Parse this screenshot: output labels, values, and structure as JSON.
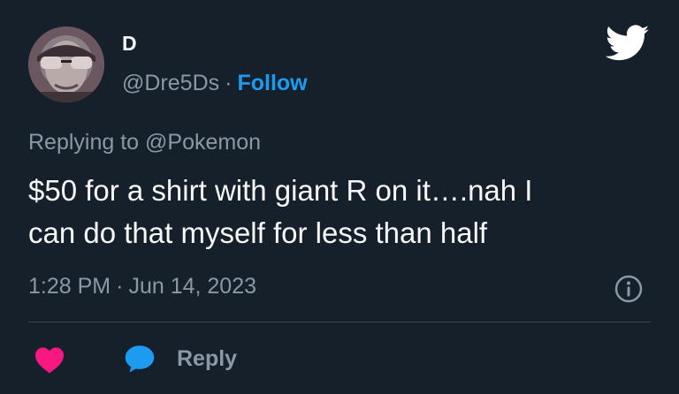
{
  "user": {
    "display_name": "D",
    "handle": "@Dre5Ds",
    "separator": "·",
    "follow_label": "Follow",
    "avatar_icon": "profile-photo-sunglasses"
  },
  "reply_context": {
    "prefix": "Replying to",
    "mention": "@Pokemon"
  },
  "tweet": {
    "lines": [
      "$50 for a shirt with giant R on it….nah I",
      "can do that myself for less than half"
    ]
  },
  "meta": {
    "time": "1:28 PM",
    "separator": "·",
    "date": "Jun 14, 2023"
  },
  "actions": {
    "reply_label": "Reply"
  },
  "icons": {
    "brand": "twitter-bird-icon",
    "info": "info-icon",
    "like": "heart-icon",
    "reply": "speech-bubble-icon"
  },
  "colors": {
    "background": "#15202b",
    "text": "#f7f9f9",
    "muted": "#8b98a5",
    "accent": "#1d9bf0",
    "like": "#f91880",
    "divider": "#38444d"
  }
}
